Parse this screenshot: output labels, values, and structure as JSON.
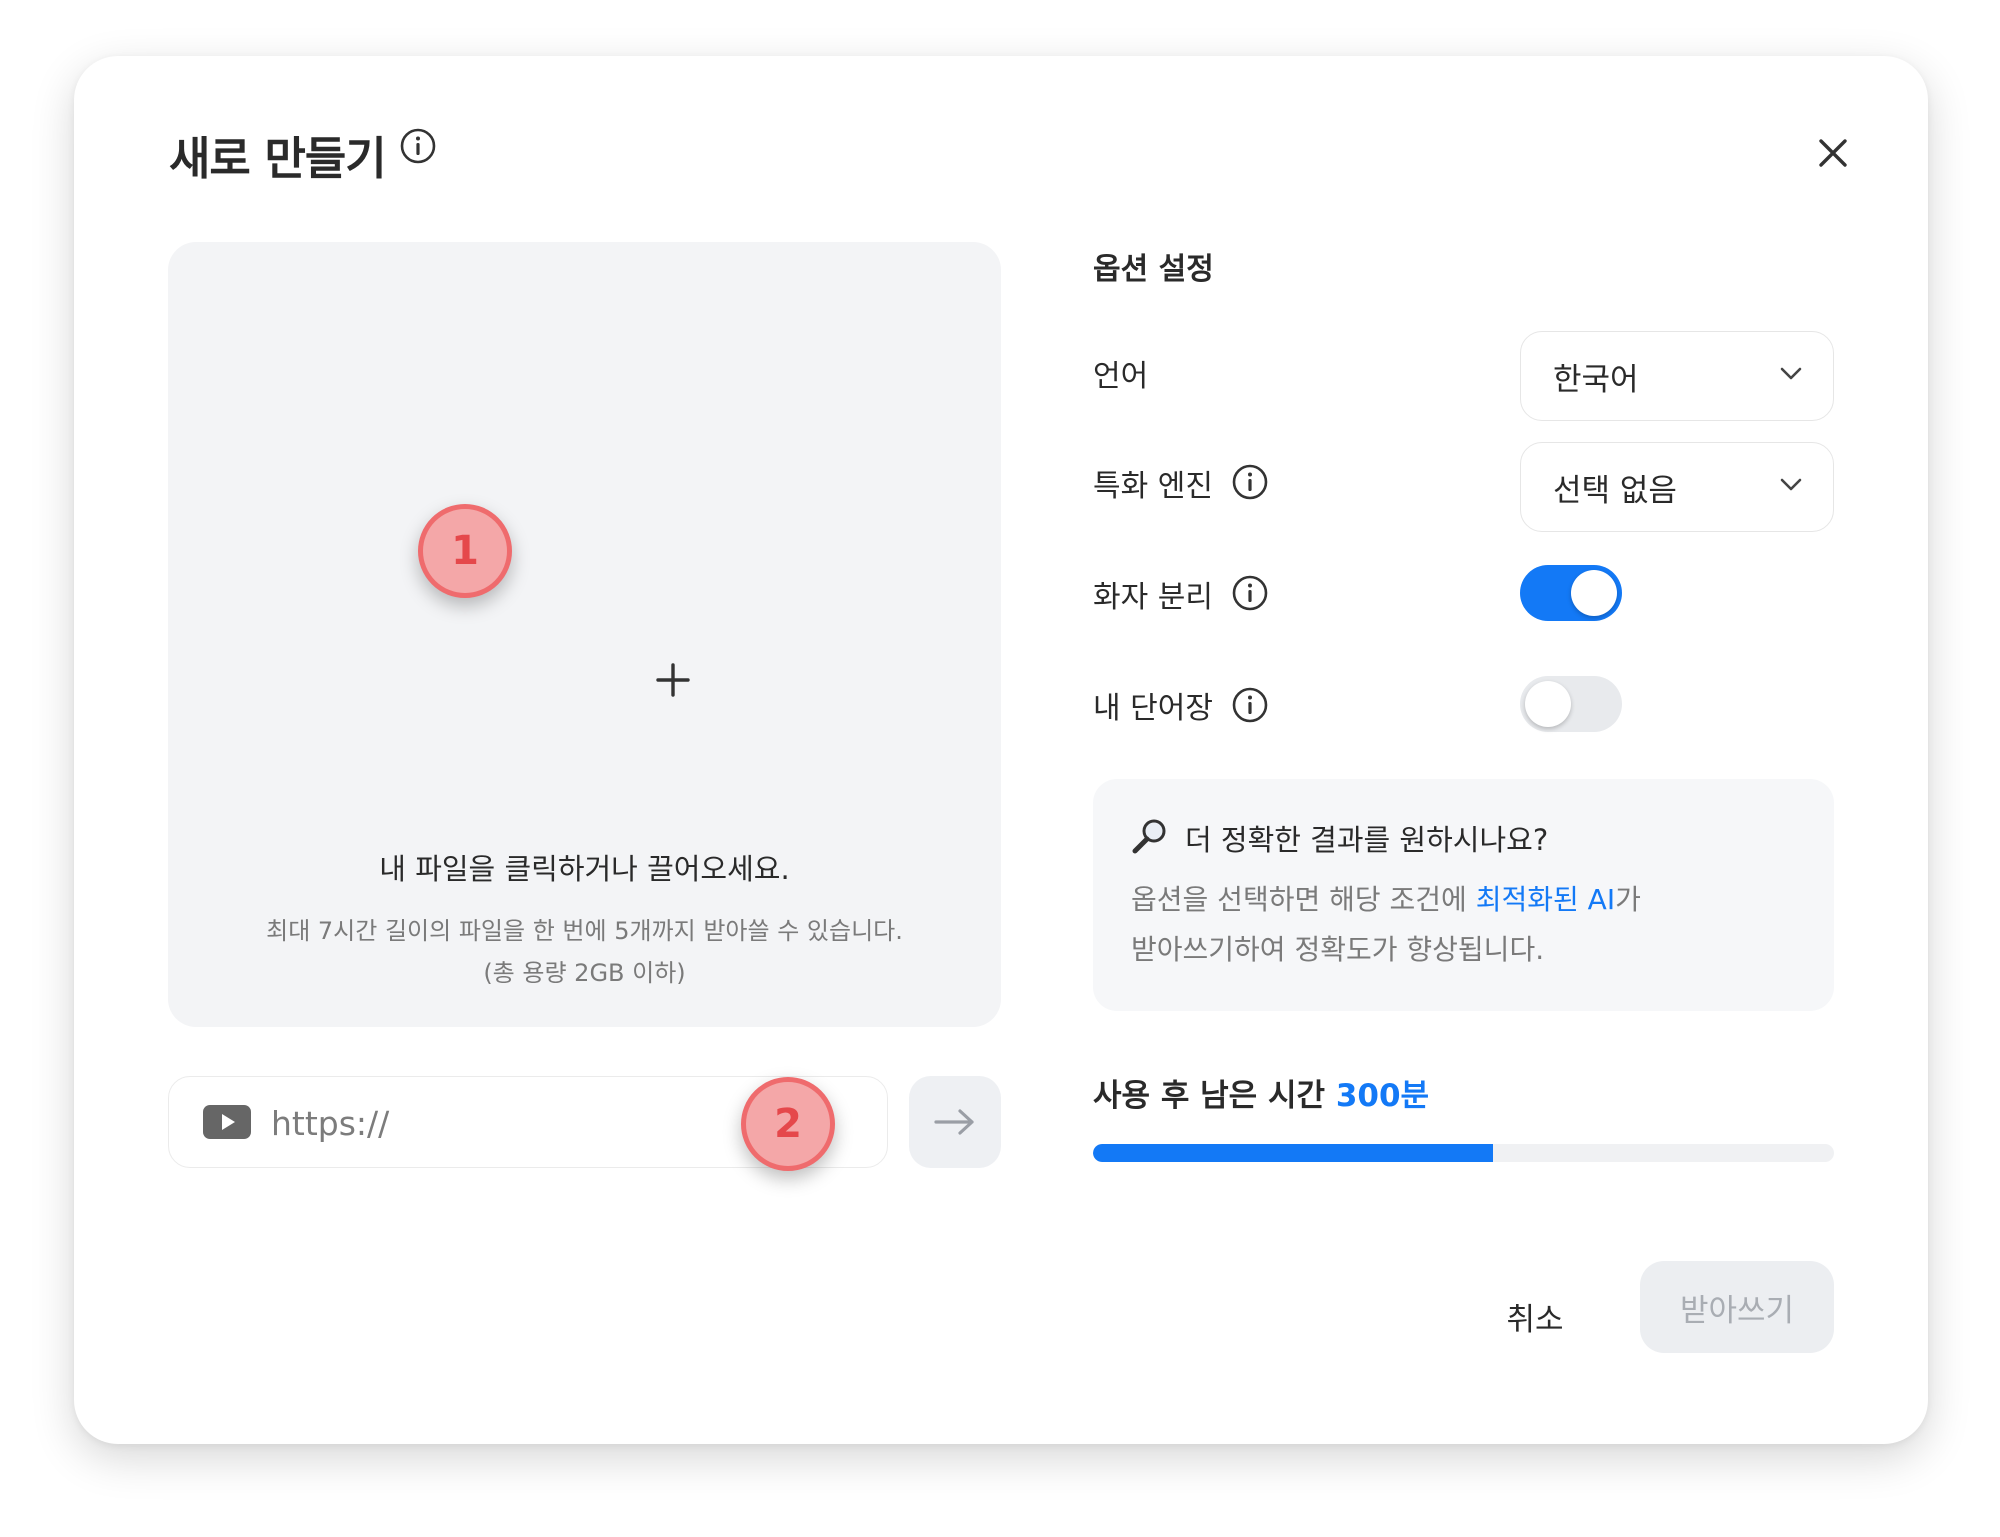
{
  "dialog": {
    "title": "새로 만들기",
    "close_icon": "close-icon",
    "title_info_icon": "info-icon"
  },
  "upload": {
    "add_icon": "plus-icon",
    "main_text": "내 파일을 클릭하거나 끌어오세요.",
    "sub_text": "최대 7시간 길이의 파일을 한 번에 5개까지 받아쓸 수 있습니다.",
    "sub_text_2": "(총 용량 2GB 이하)"
  },
  "url_input": {
    "icon": "youtube-icon",
    "placeholder": "https://",
    "value": "",
    "submit_icon": "arrow-right-icon"
  },
  "annotations": {
    "badge_1": "1",
    "badge_2": "2"
  },
  "options": {
    "section_title": "옵션 설정",
    "language": {
      "label": "언어",
      "value": "한국어"
    },
    "engine": {
      "label": "특화 엔진",
      "value": "선택 없음"
    },
    "speaker_separation": {
      "label": "화자 분리",
      "enabled": true
    },
    "my_vocabulary": {
      "label": "내 단어장",
      "enabled": false
    }
  },
  "tip": {
    "icon": "magnifier-icon",
    "title": "더 정확한 결과를 원하시나요?",
    "body_1": "옵션을 선택하면 해당 조건에 ",
    "body_highlight": "최적화된 AI",
    "body_2": "가",
    "body_3": "받아쓰기하여 정확도가 향상됩니다."
  },
  "usage": {
    "label": "사용 후 남은 시간",
    "value": "300분",
    "progress_fraction": 0.54
  },
  "footer": {
    "cancel_label": "취소",
    "submit_label": "받아쓰기"
  },
  "colors": {
    "accent": "#1379f6",
    "badge_ring": "#ef6b6d",
    "badge_fill": "#f4a7a8",
    "dropzone_bg": "#f3f4f6",
    "disabled_button_bg": "#eceef1",
    "youtube_icon": "#666666"
  }
}
